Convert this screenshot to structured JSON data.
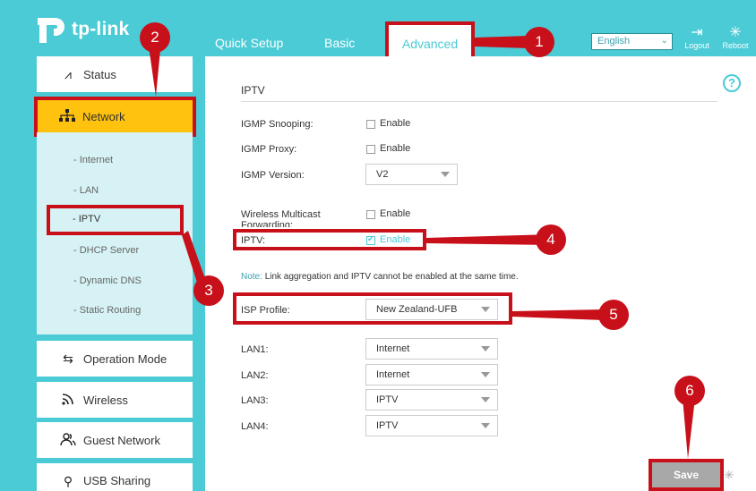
{
  "header": {
    "brand": "tp-link",
    "tabs": [
      "Quick Setup",
      "Basic",
      "Advanced"
    ],
    "active_tab": "Advanced",
    "language": "English",
    "logout": "Logout",
    "reboot": "Reboot"
  },
  "sidebar": {
    "items": [
      {
        "label": "Status",
        "icon": "pulse-icon"
      },
      {
        "label": "Network",
        "icon": "network-icon"
      },
      {
        "label": "Operation Mode",
        "icon": "swap-icon"
      },
      {
        "label": "Wireless",
        "icon": "wifi-icon"
      },
      {
        "label": "Guest Network",
        "icon": "users-icon"
      },
      {
        "label": "USB Sharing",
        "icon": "usb-icon"
      }
    ],
    "sub_items": [
      "- Internet",
      "- LAN",
      "- IPTV",
      "- DHCP Server",
      "- Dynamic DNS",
      "- Static Routing"
    ]
  },
  "main": {
    "section_title": "IPTV",
    "fields": {
      "igmp_snooping": {
        "label": "IGMP Snooping:",
        "option": "Enable"
      },
      "igmp_proxy": {
        "label": "IGMP Proxy:",
        "option": "Enable"
      },
      "igmp_version": {
        "label": "IGMP Version:",
        "value": "V2"
      },
      "wireless_multicast": {
        "label": "Wireless Multicast Forwarding:",
        "option": "Enable"
      },
      "iptv": {
        "label": "IPTV:",
        "option": "Enable"
      },
      "isp_profile": {
        "label": "ISP Profile:",
        "value": "New Zealand-UFB"
      },
      "lan1": {
        "label": "LAN1:",
        "value": "Internet"
      },
      "lan2": {
        "label": "LAN2:",
        "value": "Internet"
      },
      "lan3": {
        "label": "LAN3:",
        "value": "IPTV"
      },
      "lan4": {
        "label": "LAN4:",
        "value": "IPTV"
      }
    },
    "note_prefix": "Note:",
    "note_text": "Link aggregation and IPTV cannot be enabled at the same time.",
    "save_label": "Save"
  },
  "callouts": [
    "1",
    "2",
    "3",
    "4",
    "5",
    "6"
  ],
  "colors": {
    "teal": "#4acbd6",
    "highlight_red": "#c8101a",
    "active_yellow": "#ffc20e"
  }
}
